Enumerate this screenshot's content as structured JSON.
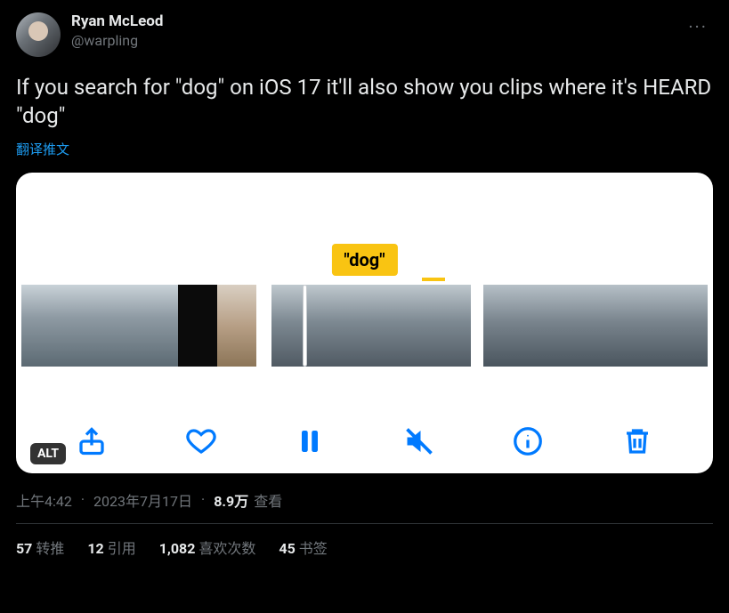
{
  "author": {
    "display_name": "Ryan McLeod",
    "handle": "@warpling"
  },
  "more_label": "···",
  "body_text": "If you search for \"dog\" on iOS 17 it'll also show you clips where it's HEARD \"dog\"",
  "translate_link": "翻译推文",
  "media": {
    "search_term": "\"dog\"",
    "alt_badge": "ALT",
    "toolbar": {
      "share": "share",
      "like": "like",
      "pause": "pause",
      "mute": "mute",
      "info": "info",
      "delete": "delete"
    }
  },
  "meta": {
    "time": "上午4:42",
    "date": "2023年7月17日",
    "views_count": "8.9万",
    "views_label": "查看"
  },
  "stats": {
    "retweets_count": "57",
    "retweets_label": "转推",
    "quotes_count": "12",
    "quotes_label": "引用",
    "likes_count": "1,082",
    "likes_label": "喜欢次数",
    "bookmarks_count": "45",
    "bookmarks_label": "书签"
  }
}
